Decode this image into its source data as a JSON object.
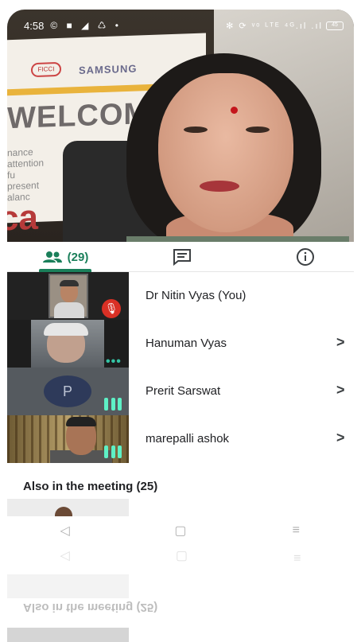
{
  "status_bar": {
    "time": "4:58",
    "left_icons": "© ■ ◢ ♺ •",
    "right_icons": "✻ ⟳ ᵛᵒ ᴸᵀᴱ ⁴ᴳ.ıl .ıl",
    "battery": "45"
  },
  "video": {
    "logo_ficci": "FICCI",
    "logo_brand": "SAMSUNG",
    "welcome_text": "WELCOM",
    "side_words": "nance\nattention\nfu\npresent\nalanc",
    "side_big": "ca"
  },
  "tabs": {
    "people_count": "(29)",
    "people_icon": "people-icon",
    "chat_icon": "chat-icon",
    "info_icon": "info-icon",
    "accent": "#1a7f5a"
  },
  "participants": [
    {
      "name": "Dr Nitin Vyas (You)",
      "muted": true
    },
    {
      "name": "Hanuman Vyas",
      "chevron": ">",
      "more": "•••"
    },
    {
      "name": "Prerit Sarswat",
      "chevron": ">",
      "initial": "P"
    },
    {
      "name": "marepalli ashok",
      "chevron": ">"
    }
  ],
  "also_in_meeting": "Also in the meeting (25)",
  "nav": {
    "back": "◁",
    "home": "▢",
    "recents": "≡"
  },
  "reflection": {
    "also_text": "Also in the meeting (25)"
  }
}
